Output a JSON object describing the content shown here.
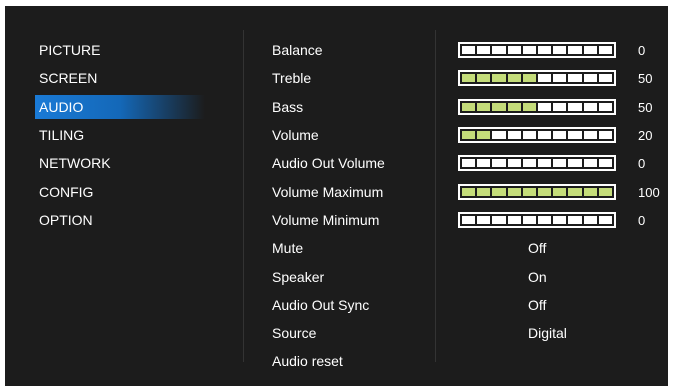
{
  "menu": {
    "items": [
      {
        "label": "PICTURE"
      },
      {
        "label": "SCREEN"
      },
      {
        "label": "AUDIO",
        "selected": true
      },
      {
        "label": "TILING"
      },
      {
        "label": "NETWORK"
      },
      {
        "label": "CONFIG"
      },
      {
        "label": "OPTION"
      }
    ]
  },
  "audio": {
    "sliders": [
      {
        "label": "Balance",
        "value": "0",
        "level": 0
      },
      {
        "label": "Treble",
        "value": "50",
        "level": 5
      },
      {
        "label": "Bass",
        "value": "50",
        "level": 5
      },
      {
        "label": "Volume",
        "value": "20",
        "level": 2
      },
      {
        "label": "Audio Out Volume",
        "value": "0",
        "level": 0
      },
      {
        "label": "Volume Maximum",
        "value": "100",
        "level": 10
      },
      {
        "label": "Volume Minimum",
        "value": "0",
        "level": 0
      }
    ],
    "options": [
      {
        "label": "Mute",
        "value": "Off"
      },
      {
        "label": "Speaker",
        "value": "On"
      },
      {
        "label": "Audio Out Sync",
        "value": "Off"
      },
      {
        "label": "Source",
        "value": "Digital"
      },
      {
        "label": "Audio reset",
        "value": ""
      }
    ]
  },
  "colors": {
    "background": "#1c1c1c",
    "selected": "#1a7ad6",
    "slider_fill": "#c4dc7a",
    "slider_empty": "#ffffff"
  }
}
